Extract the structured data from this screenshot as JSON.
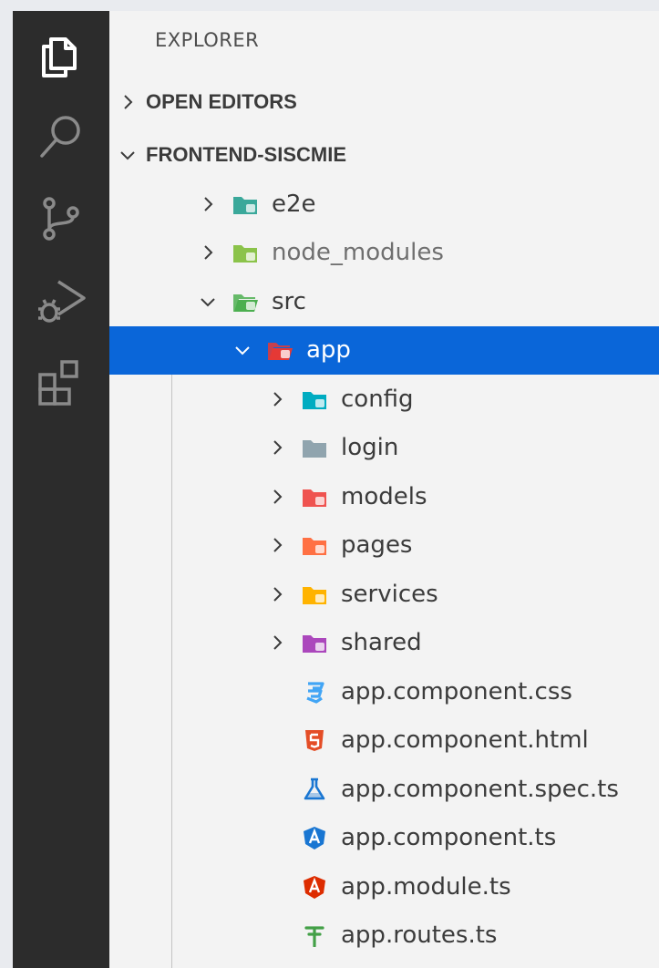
{
  "colors": {
    "activity_bar": "#2c2c2c",
    "sidebar": "#f3f3f3",
    "selection": "#0a66d9"
  },
  "activity_bar": {
    "items": [
      {
        "icon": "files-icon"
      },
      {
        "icon": "search-icon"
      },
      {
        "icon": "source-control-icon"
      },
      {
        "icon": "run-debug-icon"
      },
      {
        "icon": "extensions-icon"
      }
    ]
  },
  "explorer": {
    "title": "EXPLORER",
    "open_editors": "OPEN EDITORS",
    "project": "FRONTEND-SISCMIE",
    "tree": [
      {
        "label": "e2e",
        "icon": "folder-e2e-icon",
        "color": "#3aa89a"
      },
      {
        "label": "node_modules",
        "icon": "folder-node-icon",
        "color": "#8bc34a"
      },
      {
        "label": "src",
        "icon": "folder-src-open-icon",
        "color": "#4caf50"
      },
      {
        "label": "app",
        "icon": "folder-app-open-icon",
        "color": "#e53935"
      },
      {
        "label": "config",
        "icon": "folder-config-icon",
        "color": "#00acc1"
      },
      {
        "label": "login",
        "icon": "folder-login-icon",
        "color": "#90a4ae"
      },
      {
        "label": "models",
        "icon": "folder-models-icon",
        "color": "#ef5350"
      },
      {
        "label": "pages",
        "icon": "folder-pages-icon",
        "color": "#ff7043"
      },
      {
        "label": "services",
        "icon": "folder-services-icon",
        "color": "#ffb300"
      },
      {
        "label": "shared",
        "icon": "folder-shared-icon",
        "color": "#ab47bc"
      },
      {
        "label": "app.component.css",
        "icon": "css-file-icon",
        "color": "#42a5f5"
      },
      {
        "label": "app.component.html",
        "icon": "html-file-icon",
        "color": "#e44d26"
      },
      {
        "label": "app.component.spec.ts",
        "icon": "test-file-icon",
        "color": "#1976d2"
      },
      {
        "label": "app.component.ts",
        "icon": "angular-component-icon",
        "color": "#1976d2"
      },
      {
        "label": "app.module.ts",
        "icon": "angular-module-icon",
        "color": "#dd2c00"
      },
      {
        "label": "app.routes.ts",
        "icon": "angular-routing-icon",
        "color": "#43a047"
      }
    ]
  }
}
